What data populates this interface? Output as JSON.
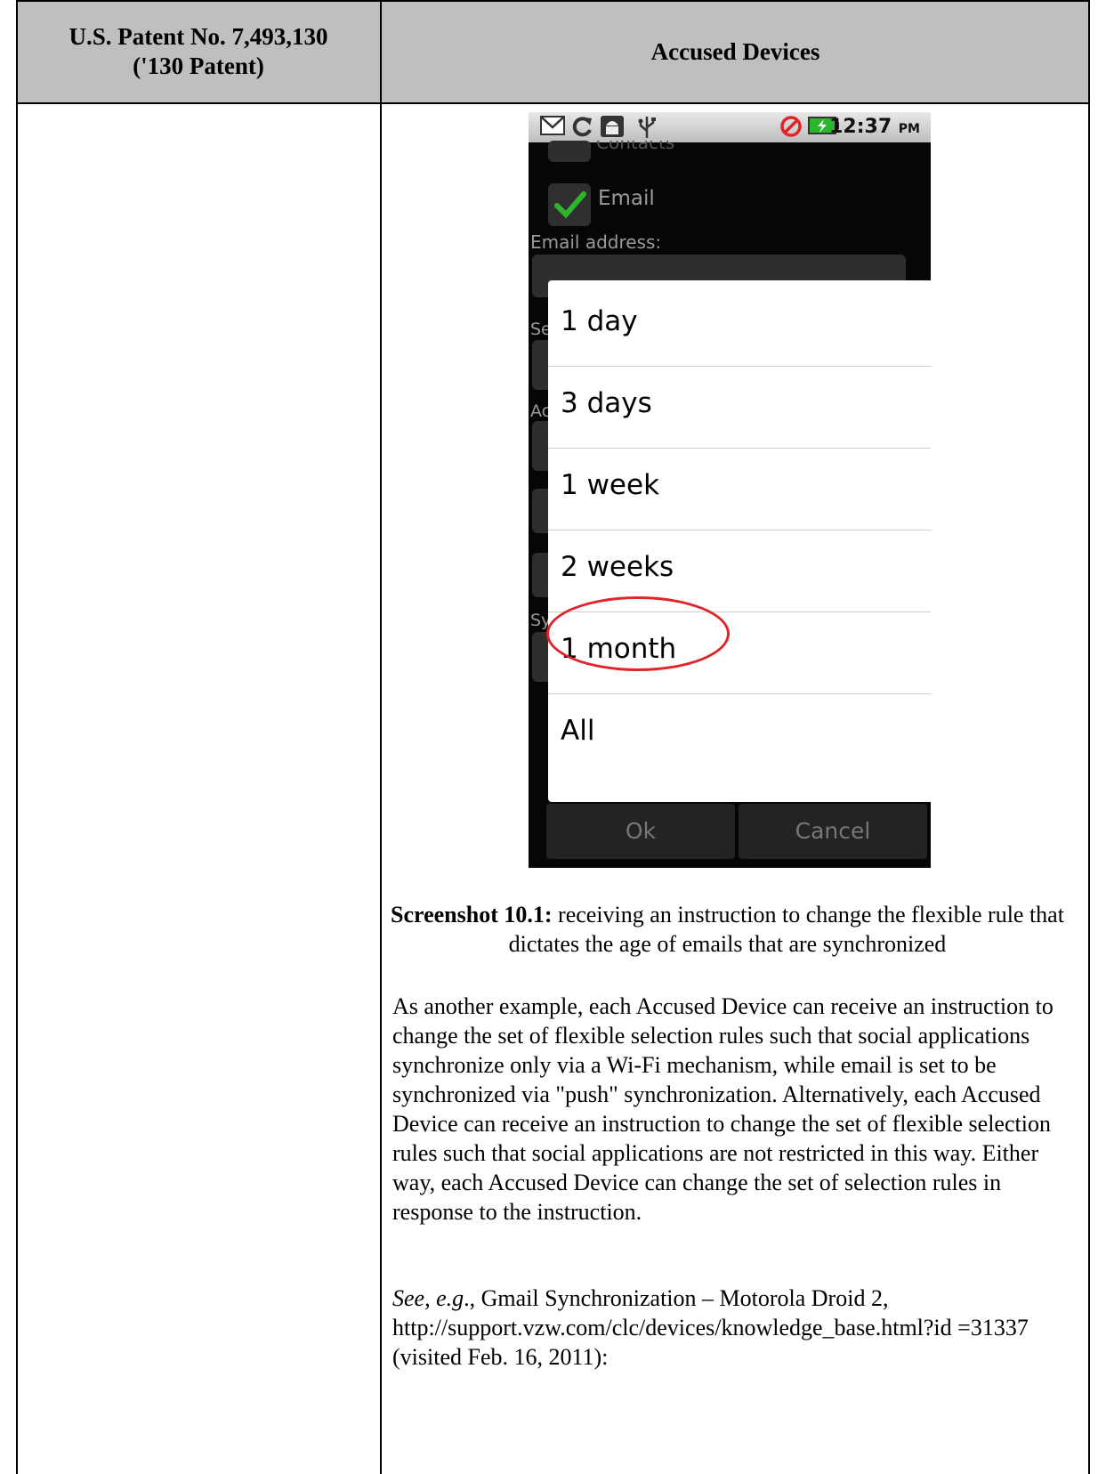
{
  "header": {
    "col1": "U.S. Patent No. 7,493,130\n('130 Patent)",
    "col2": "Accused Devices"
  },
  "phone": {
    "status_time": "12:37",
    "status_ampm": "PM",
    "icons": [
      "gmail-icon",
      "sync-icon",
      "android-debug-icon",
      "usb-icon",
      "no-signal-icon",
      "battery-charging-icon"
    ],
    "bg_email_label": "Email",
    "bg_email_address_label": "Email address:",
    "bg_partial_top": "Contacts",
    "bg_left_letters": [
      "Se",
      "Ac",
      "Sy"
    ],
    "options": [
      "1 day",
      "3 days",
      "1 week",
      "2 weeks",
      "1 month",
      "All"
    ],
    "ok_label": "Ok",
    "cancel_label": "Cancel",
    "highlight_color": "#e0242a",
    "check_color": "#2db52d"
  },
  "caption": {
    "bold": "Screenshot 10.1:",
    "text": " receiving an instruction to change the flexible rule that dictates the age of emails that are synchronized"
  },
  "paragraph1": "As another example, each Accused Device can receive an instruction to change the set of flexible selection rules such that social applications synchronize only via a Wi-Fi mechanism, while email is set to be synchronized via \"push\" synchronization.  Alternatively, each Accused Device can receive an instruction to change the set of flexible selection rules such that social applications are not restricted in this way.  Either way, each Accused Device can change the set of selection rules in response to the instruction.",
  "citation": {
    "italic": "See, e.g",
    "rest": "., Gmail Synchronization – Motorola Droid 2, http://support.vzw.com/clc/devices/knowledge_base.html?id =31337 (visited Feb. 16, 2011):"
  }
}
